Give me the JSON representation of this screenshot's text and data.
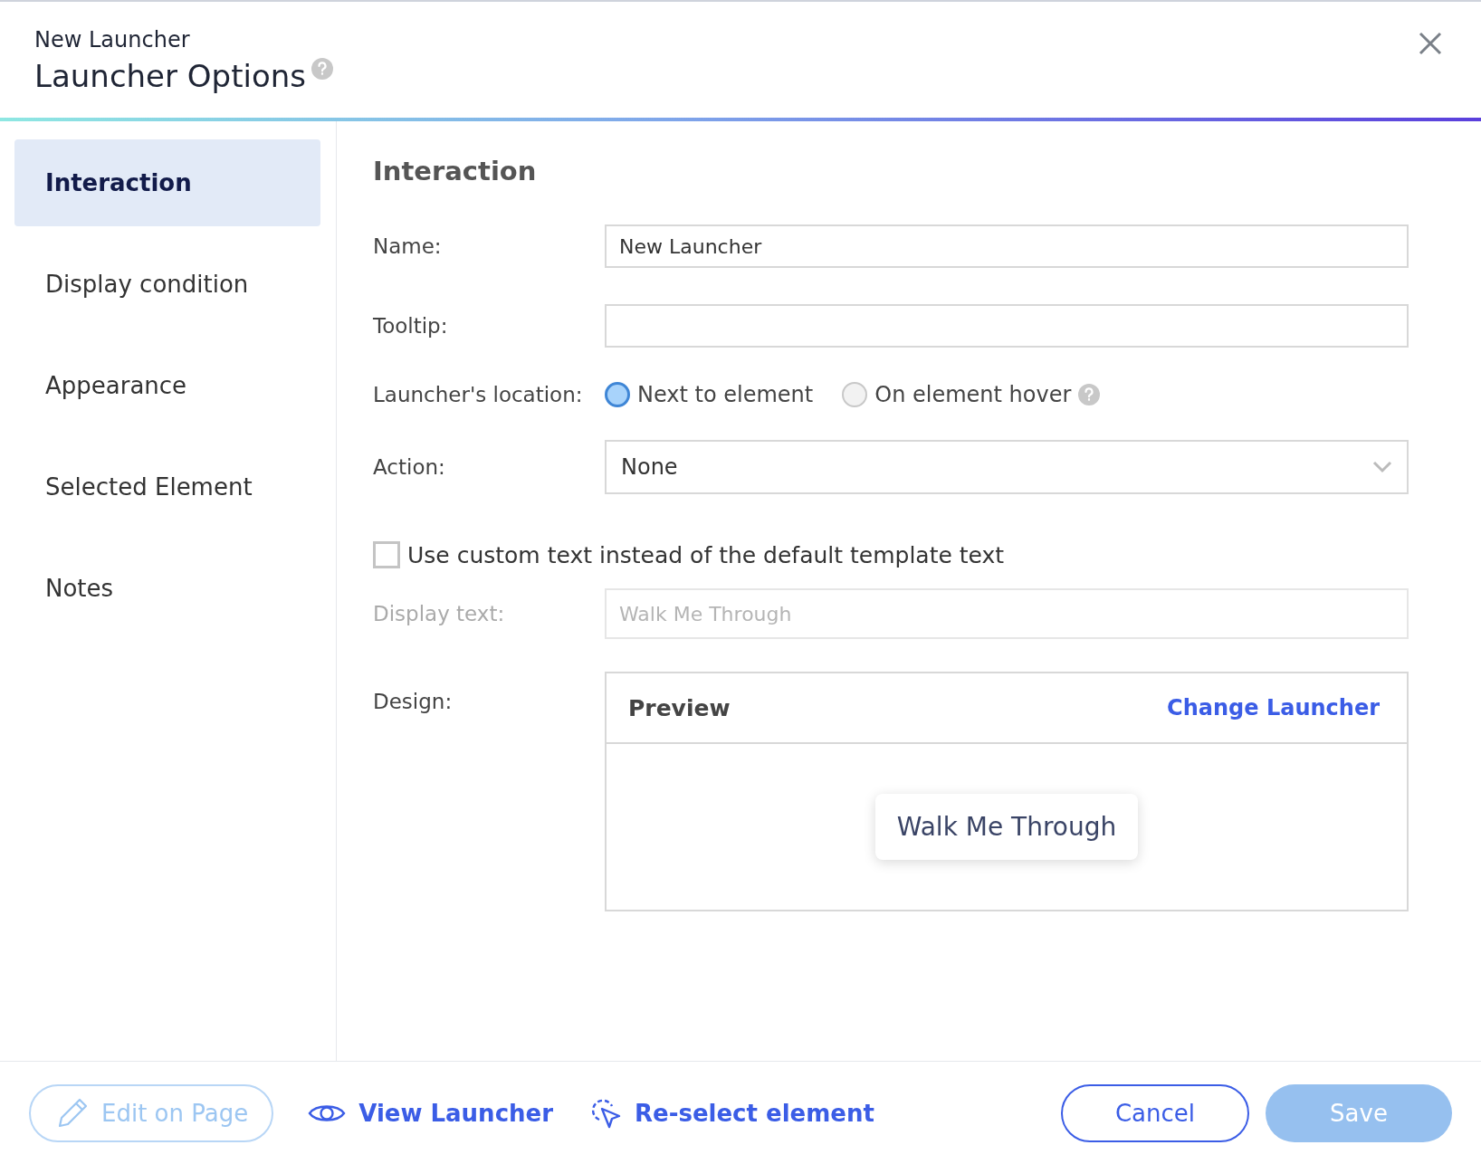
{
  "header": {
    "subtitle": "New Launcher",
    "title": "Launcher Options"
  },
  "sidebar": {
    "items": [
      {
        "label": "Interaction",
        "selected": true
      },
      {
        "label": "Display condition",
        "selected": false
      },
      {
        "label": "Appearance",
        "selected": false
      },
      {
        "label": "Selected Element",
        "selected": false
      },
      {
        "label": "Notes",
        "selected": false
      }
    ]
  },
  "section_title": "Interaction",
  "form": {
    "name": {
      "label": "Name:",
      "value": "New Launcher"
    },
    "tooltip": {
      "label": "Tooltip:"
    },
    "location": {
      "label": "Launcher's location:",
      "options": [
        {
          "label": "Next to element",
          "selected": true,
          "help": false
        },
        {
          "label": "On element hover",
          "selected": false,
          "help": true
        }
      ]
    },
    "action": {
      "label": "Action:",
      "value": "None"
    },
    "custom_text": {
      "label": "Use custom text instead of the default template text",
      "checked": false
    },
    "display_text": {
      "label": "Display text:",
      "placeholder": "Walk Me Through",
      "disabled": true
    },
    "design": {
      "label": "Design:",
      "preview_title": "Preview",
      "link": "Change Launcher",
      "launcher_text": "Walk Me Through"
    }
  },
  "footer": {
    "left": [
      {
        "kind": "edit",
        "label": "Edit on Page",
        "disabled": true
      },
      {
        "kind": "view",
        "label": "View Launcher",
        "disabled": false
      },
      {
        "kind": "reselect",
        "label": "Re-select element",
        "disabled": false
      }
    ],
    "cancel": {
      "label": "Cancel"
    },
    "save": {
      "label": "Save",
      "disabled": true
    }
  }
}
